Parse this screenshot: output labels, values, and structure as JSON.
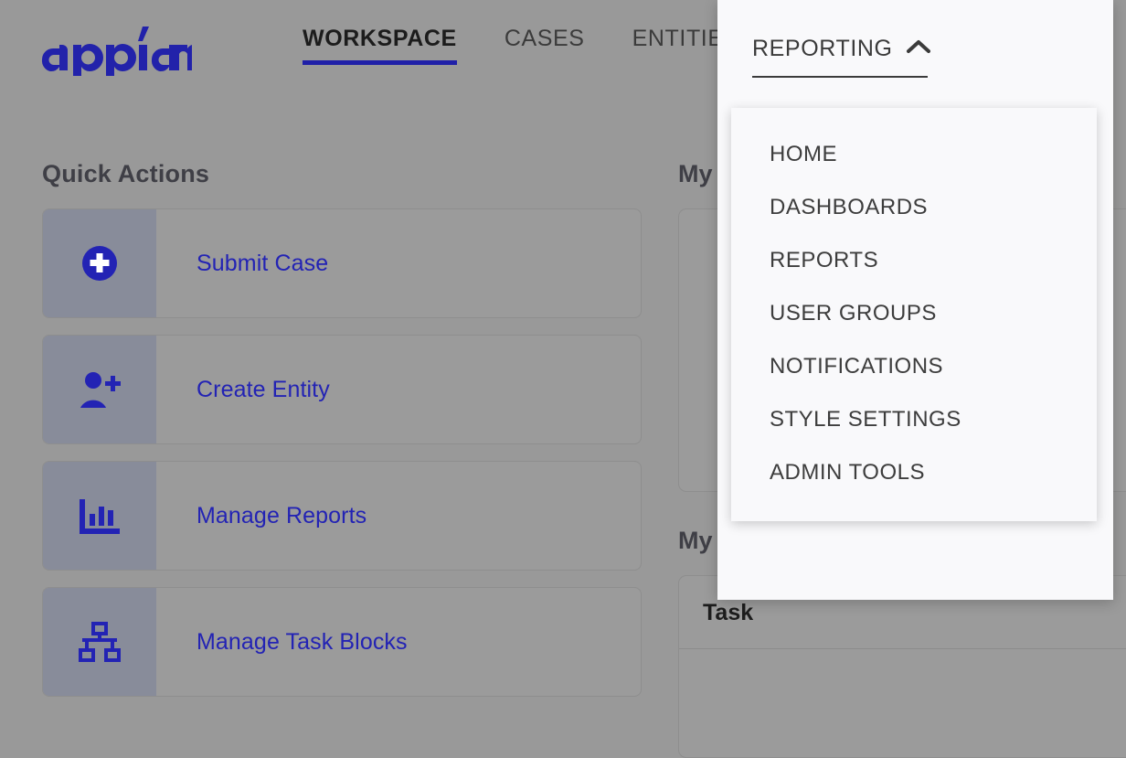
{
  "brand": {
    "logo_text": "appian",
    "logo_color": "#2222aa"
  },
  "nav": {
    "tabs": [
      {
        "label": "WORKSPACE",
        "active": true
      },
      {
        "label": "CASES",
        "active": false
      },
      {
        "label": "ENTITIES",
        "active": false
      }
    ],
    "active_underline_color": "#2020a8"
  },
  "dropdown": {
    "trigger_label": "REPORTING",
    "chevron_icon": "chevron-up-icon",
    "expanded": true,
    "items": [
      {
        "label": "HOME"
      },
      {
        "label": "DASHBOARDS"
      },
      {
        "label": "REPORTS"
      },
      {
        "label": "USER GROUPS"
      },
      {
        "label": "NOTIFICATIONS"
      },
      {
        "label": "STYLE SETTINGS"
      },
      {
        "label": "ADMIN TOOLS"
      }
    ]
  },
  "quick_actions": {
    "title": "Quick Actions",
    "link_color": "#2323b4",
    "cards": [
      {
        "label": "Submit Case",
        "icon": "plus-circle-icon"
      },
      {
        "label": "Create Entity",
        "icon": "user-plus-icon"
      },
      {
        "label": "Manage Reports",
        "icon": "bar-chart-icon"
      },
      {
        "label": "Manage Task Blocks",
        "icon": "sitemap-icon"
      }
    ]
  },
  "right_panels": {
    "panel_one_title": "My",
    "panel_two_title": "My",
    "task_table": {
      "columns": [
        "Task"
      ]
    }
  },
  "theme": {
    "page_dim_background": "#999999",
    "card_background": "#9b9b9b",
    "card_border": "#8e8e8e",
    "icon_pane_background": "#888c9a",
    "overlay_background": "#f9f9fb",
    "heading_color": "#3f3f46"
  }
}
